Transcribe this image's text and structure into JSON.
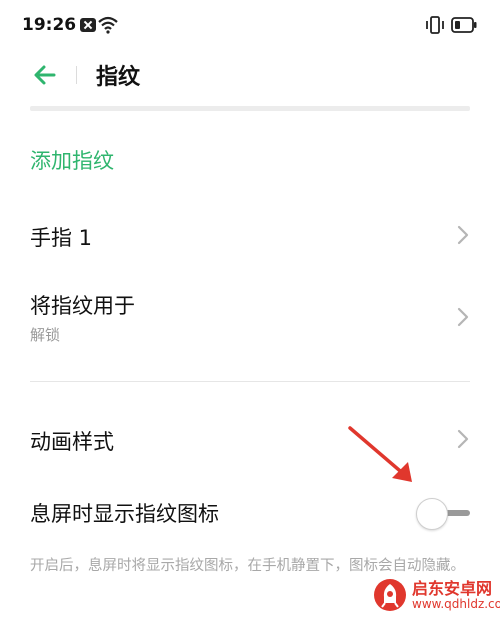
{
  "status_bar": {
    "time": "19:26",
    "icons": [
      "notification-icon",
      "wifi-icon",
      "vibrate-icon",
      "battery-icon"
    ]
  },
  "header": {
    "back_icon": "arrow-left-icon",
    "title": "指纹"
  },
  "sections": {
    "add_fingerprint": {
      "label": "添加指纹"
    },
    "finger_1": {
      "label": "手指 1"
    },
    "use_fingerprint_for": {
      "label": "将指纹用于",
      "subtitle": "解锁"
    },
    "animation_style": {
      "label": "动画样式"
    },
    "aod_fingerprint_icon": {
      "label": "息屏时显示指纹图标",
      "toggle_on": false,
      "description": "开启后，息屏时将显示指纹图标，在手机静置下，图标会自动隐藏。"
    }
  },
  "watermark": {
    "title": "启东安卓网",
    "url": "www.qdhldz.com"
  },
  "colors": {
    "accent": "#2fb56e",
    "annotation_arrow": "#e0372d"
  }
}
